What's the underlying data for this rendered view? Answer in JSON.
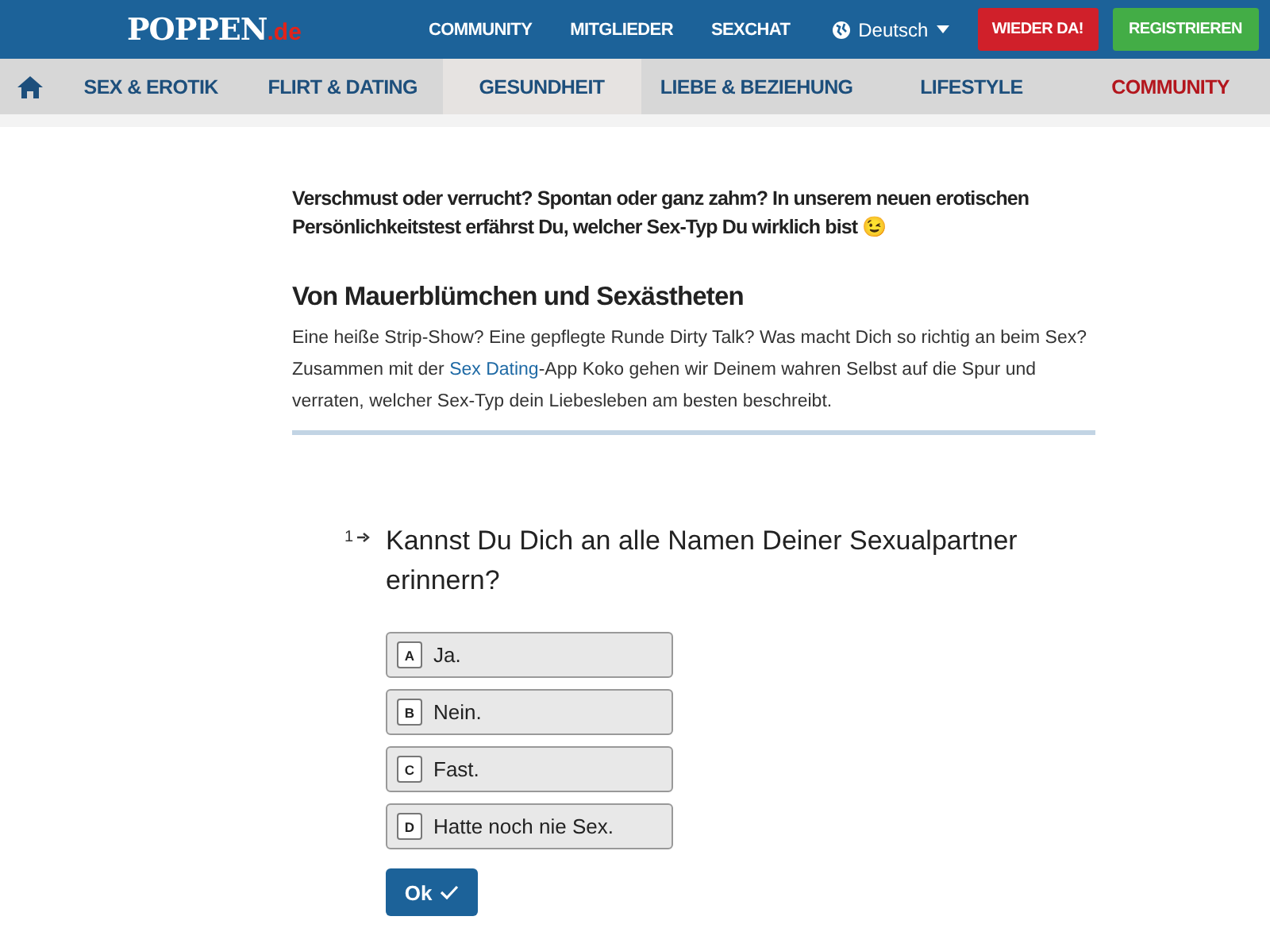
{
  "header": {
    "logo": {
      "name": "POPPEN",
      "suffix": ".de"
    },
    "links": [
      "COMMUNITY",
      "MITGLIEDER",
      "SEXCHAT"
    ],
    "language": "Deutsch",
    "buttons": [
      {
        "label": "WIEDER DA!",
        "kind": "login"
      },
      {
        "label": "REGISTRIEREN",
        "kind": "register"
      }
    ]
  },
  "nav": [
    {
      "label": "SEX & EROTIK",
      "selected": false,
      "accent": false
    },
    {
      "label": "FLIRT & DATING",
      "selected": false,
      "accent": false
    },
    {
      "label": "GESUNDHEIT",
      "selected": true,
      "accent": false
    },
    {
      "label": "LIEBE & BEZIEHUNG",
      "selected": false,
      "accent": false
    },
    {
      "label": "LIFESTYLE",
      "selected": false,
      "accent": false
    },
    {
      "label": "COMMUNITY",
      "selected": false,
      "accent": true
    }
  ],
  "article": {
    "intro": "Verschmust oder verrucht? Spontan oder ganz zahm? In unserem neuen erotischen Persönlichkeitstest erfährst Du, welcher Sex-Typ Du wirklich bist 😉",
    "heading": "Von Mauerblümchen und Sexästheten",
    "body_before": "Eine heiße Strip-Show? Eine gepflegte Runde Dirty Talk? Was macht Dich so richtig an beim Sex? Zusammen mit der ",
    "link": "Sex Dating",
    "body_after": "-App Koko gehen wir Deinem wahren Selbst auf die Spur und verraten, welcher Sex-Typ dein Liebesleben am besten beschreibt."
  },
  "quiz": {
    "number": "1",
    "question": "Kannst Du Dich an alle Namen Deiner Sexualpartner erinnern?",
    "options": [
      {
        "key": "A",
        "label": "Ja.",
        "selected": false
      },
      {
        "key": "B",
        "label": "Nein.",
        "selected": false
      },
      {
        "key": "C",
        "label": "Fast.",
        "selected": false
      },
      {
        "key": "D",
        "label": "Hatte noch nie Sex.",
        "selected": false
      }
    ],
    "submit": "Ok"
  }
}
